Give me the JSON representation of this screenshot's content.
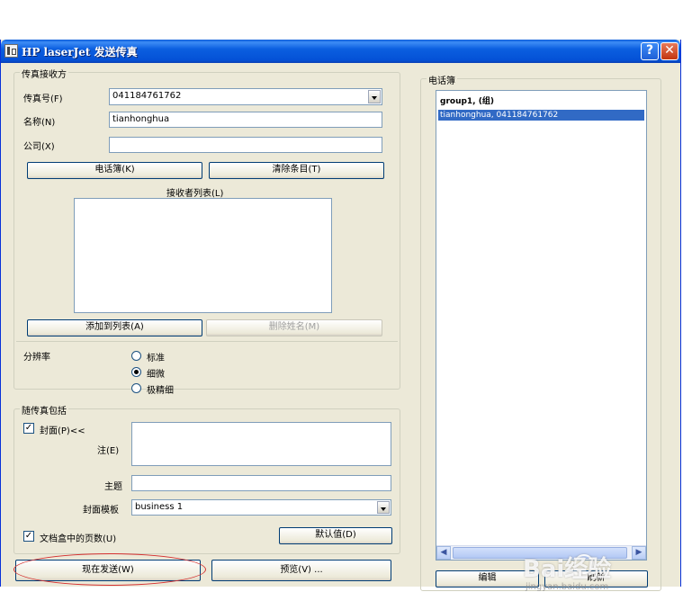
{
  "window": {
    "title": "HP laserJet 发送传真",
    "help_label": "?",
    "close_label": "✕",
    "app_icon": "fax-icon"
  },
  "recipient": {
    "group_title": "传真接收方",
    "fax_label": "传真号(F)",
    "fax_value": "041184761762",
    "name_label": "名称(N)",
    "name_value": "tianhonghua",
    "company_label": "公司(X)",
    "company_value": "",
    "phonebook_button": "电话簿(K)",
    "clear_button": "清除条目(T)",
    "list_label": "接收者列表(L)",
    "add_button": "添加到列表(A)",
    "remove_button": "删除姓名(M)"
  },
  "resolution": {
    "label": "分辨率",
    "options": [
      "标准",
      "细微",
      "极精细"
    ],
    "selected": "细微"
  },
  "include": {
    "group_title": "随传真包括",
    "cover_label": "封面(P)<<",
    "cover_checked": true,
    "note_label": "注(E)",
    "note_value": "",
    "subject_label": "主题",
    "subject_value": "",
    "template_label": "封面模板",
    "template_value": "business 1",
    "pages_label": "文档盒中的页数(U)",
    "pages_checked": true,
    "default_button": "默认值(D)"
  },
  "actions": {
    "send_button": "现在发送(W)",
    "preview_button": "预览(V) ..."
  },
  "phonebook": {
    "group_title": "电话簿",
    "entries": [
      "group1,    (组)",
      "tianhonghua, 041184761762"
    ],
    "selected_index": 1,
    "edit_button": "编辑",
    "refresh_button": "刷新"
  },
  "watermark": {
    "brand": "Bai经验",
    "url": "jingyan.baidu.com"
  },
  "colors": {
    "titlebar": "#0451d6",
    "selection": "#316ac5",
    "highlight_ellipse": "#d43030",
    "window_bg": "#ece9d8"
  }
}
